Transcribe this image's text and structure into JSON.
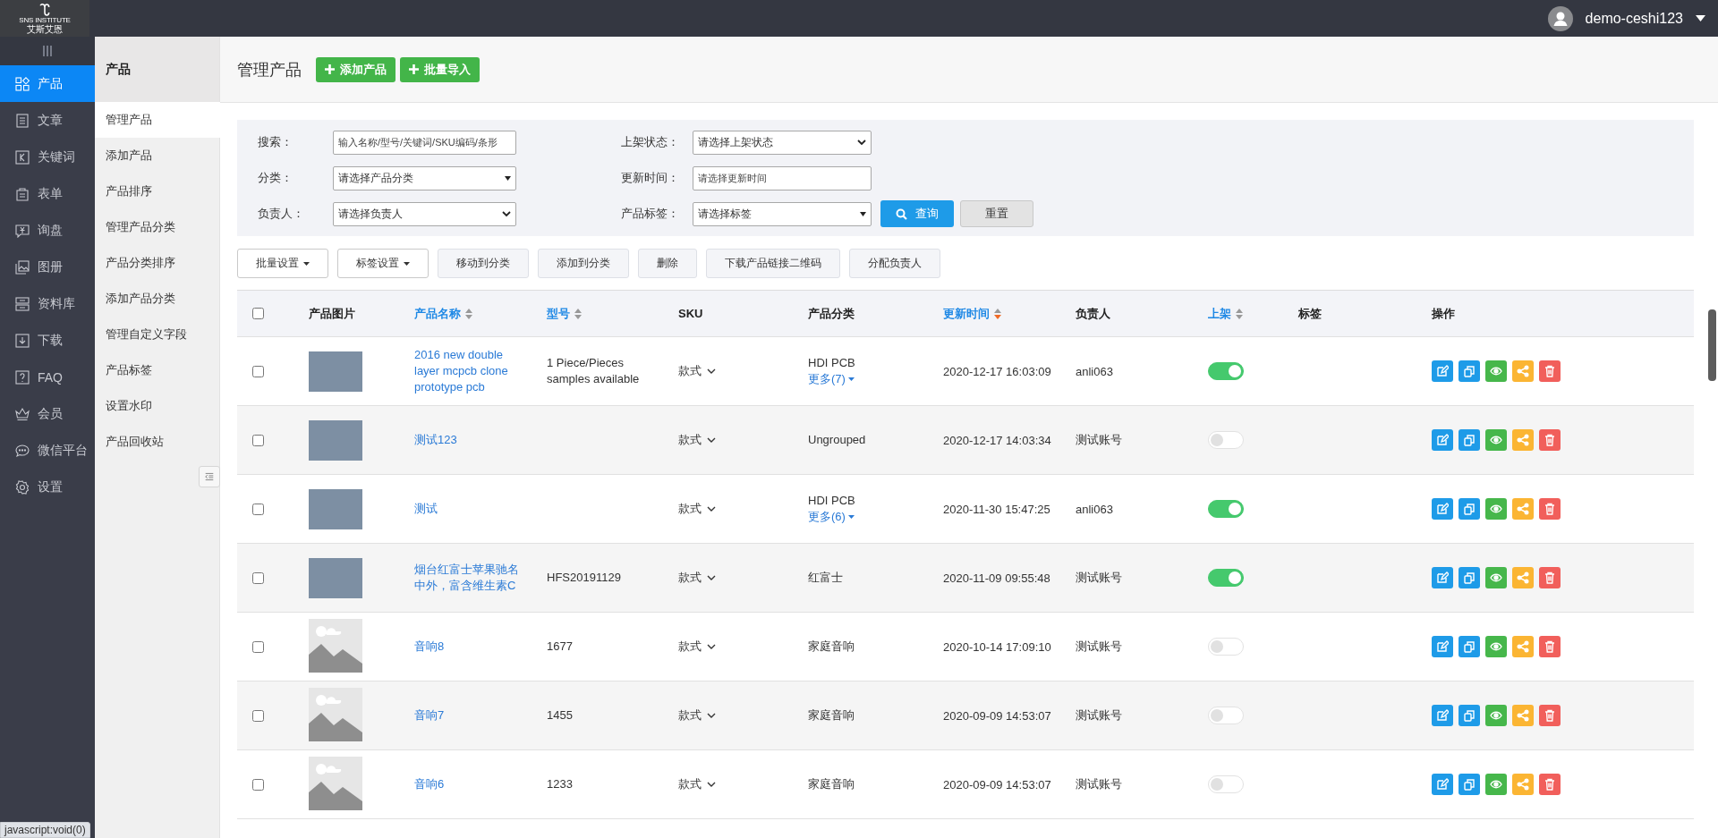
{
  "header": {
    "logo_title": "SNS INSTITUTE",
    "logo_subtitle": "艾斯艾恩",
    "user": "demo-ceshi123"
  },
  "nav": {
    "items": [
      {
        "label": "产品",
        "selected": true
      },
      {
        "label": "文章",
        "selected": false
      },
      {
        "label": "关键词",
        "selected": false
      },
      {
        "label": "表单",
        "selected": false
      },
      {
        "label": "询盘",
        "selected": false
      },
      {
        "label": "图册",
        "selected": false
      },
      {
        "label": "资料库",
        "selected": false
      },
      {
        "label": "下载",
        "selected": false
      },
      {
        "label": "FAQ",
        "selected": false
      },
      {
        "label": "会员",
        "selected": false
      },
      {
        "label": "微信平台",
        "selected": false
      },
      {
        "label": "设置",
        "selected": false
      }
    ]
  },
  "subnav": {
    "title": "产品",
    "items": [
      {
        "label": "管理产品",
        "selected": true
      },
      {
        "label": "添加产品",
        "selected": false
      },
      {
        "label": "产品排序",
        "selected": false
      },
      {
        "label": "管理产品分类",
        "selected": false
      },
      {
        "label": "产品分类排序",
        "selected": false
      },
      {
        "label": "添加产品分类",
        "selected": false
      },
      {
        "label": "管理自定义字段",
        "selected": false
      },
      {
        "label": "产品标签",
        "selected": false
      },
      {
        "label": "设置水印",
        "selected": false
      },
      {
        "label": "产品回收站",
        "selected": false
      }
    ]
  },
  "page": {
    "title": "管理产品",
    "buttons": [
      "添加产品",
      "批量导入"
    ]
  },
  "filters": {
    "fields": [
      {
        "label": "搜索：",
        "kind": "text",
        "placeholder": "输入名称/型号/关键词/SKU编码/条形"
      },
      {
        "label": "上架状态：",
        "kind": "select",
        "value": "请选择上架状态"
      },
      {
        "label": "分类：",
        "kind": "combo",
        "value": "请选择产品分类"
      },
      {
        "label": "更新时间：",
        "kind": "text",
        "placeholder": "请选择更新时间"
      },
      {
        "label": "负责人：",
        "kind": "select",
        "value": "请选择负责人"
      },
      {
        "label": "产品标签：",
        "kind": "combo",
        "value": "请选择标签"
      }
    ],
    "search_button": "查询",
    "reset_button": "重置"
  },
  "toolbar": [
    {
      "label": "批量设置",
      "kind": "menu"
    },
    {
      "label": "标签设置",
      "kind": "menu"
    },
    {
      "label": "移动到分类",
      "kind": "plain"
    },
    {
      "label": "添加到分类",
      "kind": "plain"
    },
    {
      "label": "删除",
      "kind": "plain"
    },
    {
      "label": "下载产品链接二维码",
      "kind": "plain"
    },
    {
      "label": "分配负责人",
      "kind": "plain"
    }
  ],
  "table": {
    "select_all": {
      "checked": false
    },
    "columns": [
      {
        "label": "产品图片",
        "sortable": false
      },
      {
        "label": "产品名称",
        "sortable": true,
        "sorted": false
      },
      {
        "label": "型号",
        "sortable": true,
        "sorted": false
      },
      {
        "label": "SKU",
        "sortable": false
      },
      {
        "label": "产品分类",
        "sortable": false
      },
      {
        "label": "更新时间",
        "sortable": true,
        "sorted": true
      },
      {
        "label": "负责人",
        "sortable": false
      },
      {
        "label": "上架",
        "sortable": true,
        "sorted": false
      },
      {
        "label": "标签",
        "sortable": false
      },
      {
        "label": "操作",
        "sortable": false
      }
    ],
    "rows": [
      {
        "checked": false,
        "kind": "photo",
        "name": "2016 new double layer mcpcb clone prototype pcb",
        "model": "1 Piece/Pieces samples available",
        "sku": "款式",
        "category": "HDI PCB",
        "more": "更多(7)",
        "updated": "2020-12-17 16:03:09",
        "owner": "anli063",
        "on": true
      },
      {
        "checked": false,
        "kind": "photo",
        "name": "测试123",
        "sku": "款式",
        "category": "Ungrouped",
        "updated": "2020-12-17 14:03:34",
        "owner": "测试账号",
        "on": false
      },
      {
        "checked": false,
        "kind": "photo",
        "name": "测试",
        "sku": "款式",
        "category": "HDI PCB",
        "more": "更多(6)",
        "updated": "2020-11-30 15:47:25",
        "owner": "anli063",
        "on": true
      },
      {
        "checked": false,
        "kind": "photo",
        "name": "烟台红富士苹果驰名中外，富含维生素C",
        "model": "HFS20191129",
        "sku": "款式",
        "category": "红富士",
        "updated": "2020-11-09 09:55:48",
        "owner": "测试账号",
        "on": true
      },
      {
        "checked": false,
        "kind": "placeholder",
        "name": "音响8",
        "model": "1677",
        "sku": "款式",
        "category": "家庭音响",
        "updated": "2020-10-14 17:09:10",
        "owner": "测试账号",
        "on": false
      },
      {
        "checked": false,
        "kind": "placeholder",
        "name": "音响7",
        "model": "1455",
        "sku": "款式",
        "category": "家庭音响",
        "updated": "2020-09-09 14:53:07",
        "owner": "测试账号",
        "on": false
      },
      {
        "checked": false,
        "kind": "placeholder",
        "name": "音响6",
        "model": "1233",
        "sku": "款式",
        "category": "家庭音响",
        "updated": "2020-09-09 14:53:07",
        "owner": "测试账号",
        "on": false
      }
    ]
  },
  "status_tooltip": "javascript:void(0)"
}
